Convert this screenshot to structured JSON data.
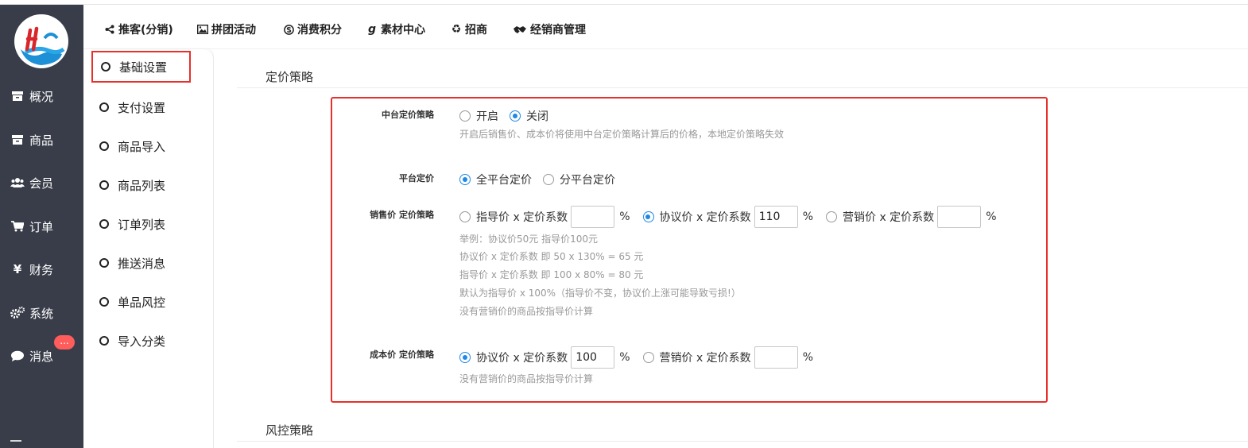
{
  "sidebar": {
    "items": [
      {
        "label": "概况",
        "icon": "archive-icon"
      },
      {
        "label": "商品",
        "icon": "archive-icon"
      },
      {
        "label": "会员",
        "icon": "users-icon"
      },
      {
        "label": "订单",
        "icon": "cart-icon"
      },
      {
        "label": "财务",
        "icon": "yen-icon"
      },
      {
        "label": "系统",
        "icon": "gears-icon"
      },
      {
        "label": "消息",
        "icon": "chat-icon"
      }
    ],
    "badge": "..."
  },
  "topnav": {
    "tabs": [
      {
        "label": "推客(分销)",
        "icon": "share-icon"
      },
      {
        "label": "拼团活动",
        "icon": "image-icon"
      },
      {
        "label": "消费积分",
        "icon": "skype-icon"
      },
      {
        "label": "素材中心",
        "icon": "gratipay-icon"
      },
      {
        "label": "招商",
        "icon": "recycle-icon"
      },
      {
        "label": "经销商管理",
        "icon": "handshake-icon"
      }
    ]
  },
  "submenu": {
    "items": [
      "基础设置",
      "支付设置",
      "商品导入",
      "商品列表",
      "订单列表",
      "推送消息",
      "单品风控",
      "导入分类"
    ],
    "active_index": 0
  },
  "pricing": {
    "section_title": "定价策略",
    "center_strategy": {
      "label": "中台定价策略",
      "options": [
        "开启",
        "关闭"
      ],
      "selected": "关闭",
      "hint": "开启后销售价、成本价将使用中台定价策略计算后的价格，本地定价策略失效"
    },
    "platform_pricing": {
      "label": "平台定价",
      "options": [
        "全平台定价",
        "分平台定价"
      ],
      "selected": "全平台定价"
    },
    "sale_strategy": {
      "label": "销售价 定价策略",
      "options": [
        {
          "label": "指导价 x 定价系数",
          "value": "",
          "selected": false
        },
        {
          "label": "协议价 x 定价系数",
          "value": "110",
          "selected": true
        },
        {
          "label": "营销价 x 定价系数",
          "value": "",
          "selected": false
        }
      ],
      "unit": "%",
      "hints": [
        "举例：协议价50元 指导价100元",
        "协议价 x 定价系数 即 50 x 130% = 65 元",
        "指导价 x 定价系数 即 100 x 80% = 80 元",
        "默认为指导价 x 100%（指导价不变，协议价上涨可能导致亏损!）",
        "没有营销价的商品按指导价计算"
      ]
    },
    "cost_strategy": {
      "label": "成本价 定价策略",
      "options": [
        {
          "label": "协议价 x 定价系数",
          "value": "100",
          "selected": true
        },
        {
          "label": "营销价 x 定价系数",
          "value": "",
          "selected": false
        }
      ],
      "unit": "%",
      "hint": "没有营销价的商品按指导价计算"
    }
  },
  "risk": {
    "section_title": "风控策略"
  },
  "colors": {
    "sidebar_bg": "#393d49",
    "highlight_red": "#e8302a",
    "radio_blue": "#1e88e5",
    "badge_red": "#ff5c5c"
  }
}
